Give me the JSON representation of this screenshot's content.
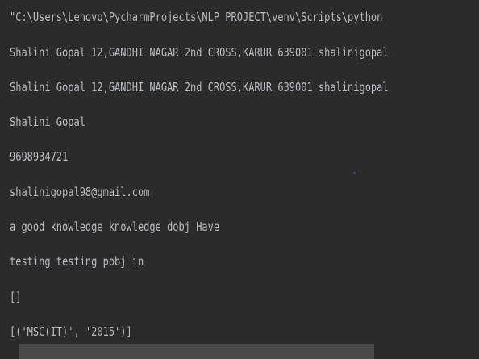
{
  "console": {
    "lines": [
      "\"C:\\Users\\Lenovo\\PycharmProjects\\NLP PROJECT\\venv\\Scripts\\python",
      "Shalini Gopal 12,GANDHI NAGAR 2nd CROSS,KARUR 639001 shalinigopal",
      "Shalini Gopal 12,GANDHI NAGAR 2nd CROSS,KARUR 639001 shalinigopal",
      "Shalini Gopal",
      "9698934721",
      "shalinigopal98@gmail.com",
      "a good knowledge knowledge dobj Have",
      "testing testing pobj in",
      "[]",
      "[('MSC(IT)', '2015')]"
    ]
  },
  "colors": {
    "background": "#2b2b2b",
    "text": "#b9bcc0",
    "scrollbar_thumb": "#4a4a4a"
  }
}
